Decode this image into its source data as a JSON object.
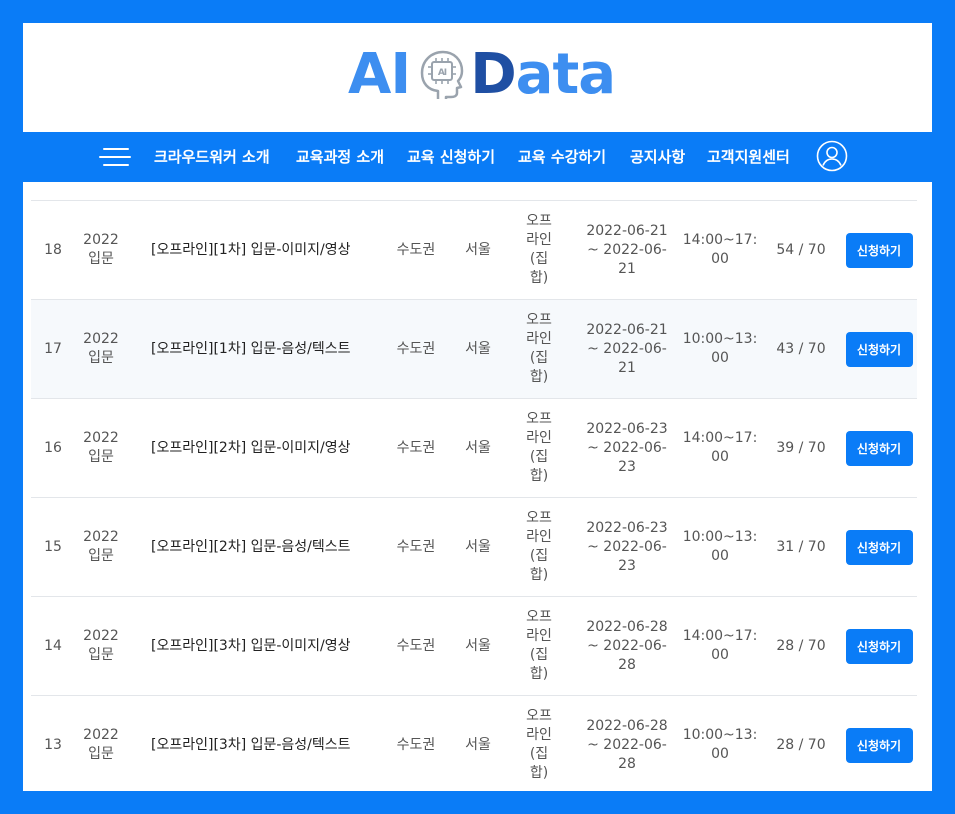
{
  "brand": {
    "logo_ai": "AI",
    "logo_chip_text": "AI",
    "logo_data_d": "D",
    "logo_data_rest": "ata"
  },
  "nav": {
    "items": [
      "크라우드워커 소개",
      "교육과정 소개",
      "교육 신청하기",
      "교육 수강하기",
      "공지사항",
      "고객지원센터"
    ]
  },
  "colors": {
    "accent": "#0a7cf7",
    "logo_light": "#3d8ef0",
    "logo_dark": "#1f4fa3"
  },
  "rows": [
    {
      "num": "18",
      "year": "2022 입문",
      "title": "[오프라인][1차] 입문-이미지/영상",
      "region": "수도권",
      "city": "서울",
      "type": "오프라인(집합)",
      "date": "2022-06-21 ~ 2022-06-21",
      "time": "14:00~17:00",
      "count": "54 / 70",
      "action": "신청하기"
    },
    {
      "num": "17",
      "year": "2022 입문",
      "title": "[오프라인][1차] 입문-음성/텍스트",
      "region": "수도권",
      "city": "서울",
      "type": "오프라인(집합)",
      "date": "2022-06-21 ~ 2022-06-21",
      "time": "10:00~13:00",
      "count": "43 / 70",
      "action": "신청하기"
    },
    {
      "num": "16",
      "year": "2022 입문",
      "title": "[오프라인][2차] 입문-이미지/영상",
      "region": "수도권",
      "city": "서울",
      "type": "오프라인(집합)",
      "date": "2022-06-23 ~ 2022-06-23",
      "time": "14:00~17:00",
      "count": "39 / 70",
      "action": "신청하기"
    },
    {
      "num": "15",
      "year": "2022 입문",
      "title": "[오프라인][2차] 입문-음성/텍스트",
      "region": "수도권",
      "city": "서울",
      "type": "오프라인(집합)",
      "date": "2022-06-23 ~ 2022-06-23",
      "time": "10:00~13:00",
      "count": "31 / 70",
      "action": "신청하기"
    },
    {
      "num": "14",
      "year": "2022 입문",
      "title": "[오프라인][3차] 입문-이미지/영상",
      "region": "수도권",
      "city": "서울",
      "type": "오프라인(집합)",
      "date": "2022-06-28 ~ 2022-06-28",
      "time": "14:00~17:00",
      "count": "28 / 70",
      "action": "신청하기"
    },
    {
      "num": "13",
      "year": "2022 입문",
      "title": "[오프라인][3차] 입문-음성/텍스트",
      "region": "수도권",
      "city": "서울",
      "type": "오프라인(집합)",
      "date": "2022-06-28 ~ 2022-06-28",
      "time": "10:00~13:00",
      "count": "28 / 70",
      "action": "신청하기"
    }
  ]
}
